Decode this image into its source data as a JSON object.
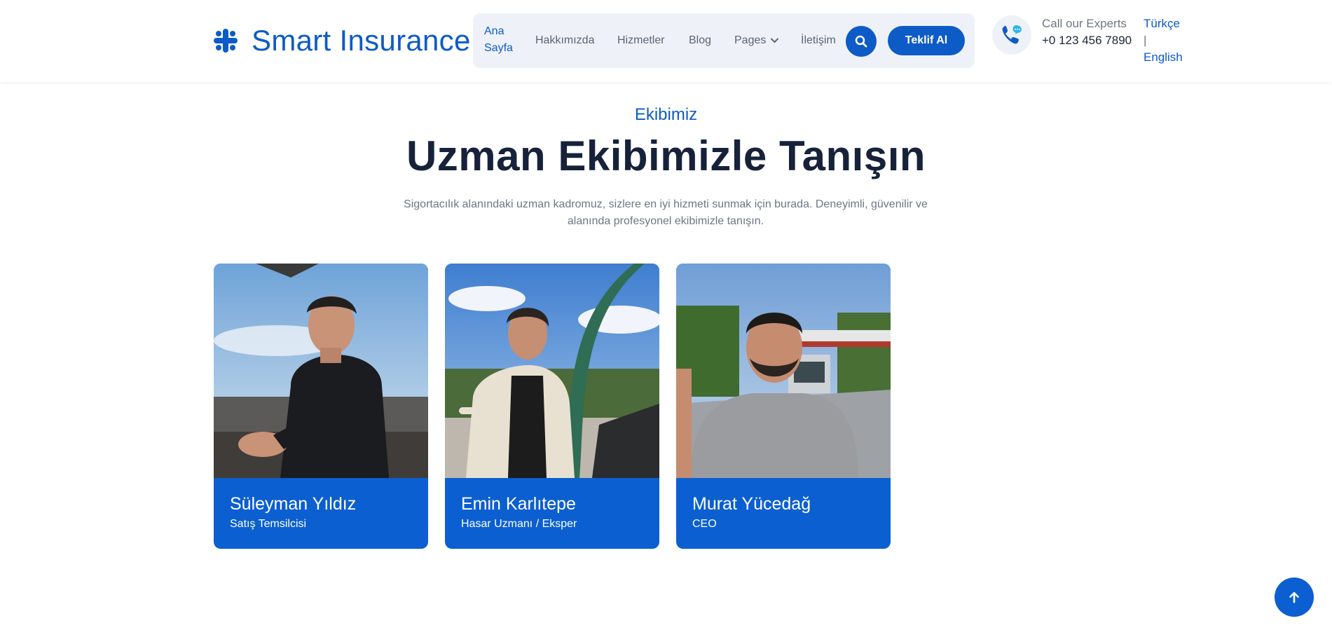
{
  "header": {
    "brand": "Smart Insurance",
    "nav": [
      {
        "label": "Ana Sayfa",
        "active": true
      },
      {
        "label": "Hakkımızda"
      },
      {
        "label": "Hizmetler"
      },
      {
        "label": "Blog"
      },
      {
        "label": "Pages"
      },
      {
        "label": "İletişim"
      }
    ],
    "search_icon": "search-icon",
    "quote_label": "Teklif Al",
    "call_label": "Call our Experts",
    "call_number": "+0 123 456 7890",
    "lang_tr": "Türkçe",
    "lang_sep": "|",
    "lang_en": "English"
  },
  "team": {
    "eyebrow": "Ekibimiz",
    "title": "Uzman Ekibimizle Tanışın",
    "description": "Sigortacılık alanındaki uzman kadromuz, sizlere en iyi hizmeti sunmak için burada. Deneyimli, güvenilir ve alanında profesyonel ekibimizle tanışın.",
    "members": [
      {
        "name": "Süleyman Yıldız",
        "role": "Satış Temsilcisi"
      },
      {
        "name": "Emin Karlıtepe",
        "role": "Hasar Uzmanı / Eksper"
      },
      {
        "name": "Murat Yücedağ",
        "role": "CEO"
      }
    ]
  },
  "colors": {
    "brand": "#0d5bc6",
    "card": "#0b5fd0",
    "nav_bg": "#eef2f8",
    "heading": "#17223a",
    "muted": "#6f7683"
  }
}
